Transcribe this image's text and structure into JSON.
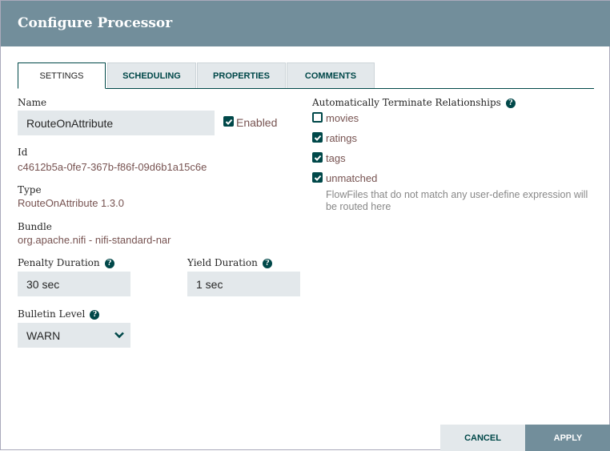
{
  "dialog": {
    "title": "Configure Processor"
  },
  "tabs": [
    {
      "label": "SETTINGS"
    },
    {
      "label": "SCHEDULING"
    },
    {
      "label": "PROPERTIES"
    },
    {
      "label": "COMMENTS"
    }
  ],
  "settings": {
    "name_label": "Name",
    "name_value": "RouteOnAttribute",
    "enabled_label": "Enabled",
    "id_label": "Id",
    "id_value": "c4612b5a-0fe7-367b-f86f-09d6b1a15c6e",
    "type_label": "Type",
    "type_value": "RouteOnAttribute 1.3.0",
    "bundle_label": "Bundle",
    "bundle_value": "org.apache.nifi - nifi-standard-nar",
    "penalty_label": "Penalty Duration",
    "penalty_value": "30 sec",
    "yield_label": "Yield Duration",
    "yield_value": "1 sec",
    "bulletin_label": "Bulletin Level",
    "bulletin_value": "WARN"
  },
  "relationships": {
    "label": "Automatically Terminate Relationships",
    "items": [
      {
        "name": "movies",
        "checked": false
      },
      {
        "name": "ratings",
        "checked": true
      },
      {
        "name": "tags",
        "checked": true
      },
      {
        "name": "unmatched",
        "checked": true
      }
    ],
    "unmatched_desc": "FlowFiles that do not match any user-define expression will be routed here"
  },
  "footer": {
    "cancel": "CANCEL",
    "apply": "APPLY"
  },
  "colors": {
    "header": "#728e9b",
    "accent": "#004849",
    "value": "#775351"
  }
}
